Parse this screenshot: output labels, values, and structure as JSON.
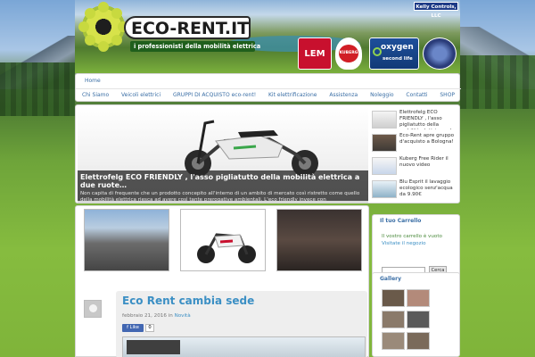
{
  "header": {
    "logo_text": "ECO-RENT.IT",
    "tagline": "i professionisti della mobilità elettrica",
    "top_badge": "Kelly Controls, LLC",
    "brands": [
      "LEM",
      "KUBERG",
      "oxygen",
      "second life"
    ]
  },
  "nav": {
    "home": "Home",
    "items": [
      "Chi Siamo",
      "Veicoli elettrici",
      "GRUPPI DI ACQUISTO eco-rent!",
      "Kit elettrificazione",
      "Assistenza",
      "Noleggio",
      "Contatti",
      "SHOP"
    ]
  },
  "slider": {
    "title": "Elettrofelg ECO FRIENDLY , l'asso pigliatutto della mobilità elettrica a due ruote…",
    "excerpt": "Non capita di frequente che un prodotto concepito all'interno di un ambito di mercato così ristretto come quello della mobilità elettrica riesca ad avere così tante prerogative ambientali. L'eco friendly invece con",
    "thumbs": [
      "Elettrofelg ECO FRIENDLY , l'asso pigliatutto della mobilità elettrica a due ruote…",
      "Eco-Rent apre gruppo d'acquisto a Bologna!",
      "Kuberg Free Rider il nuovo video",
      "Blu Esprit il lavaggio ecologico senz'acqua da 9.90€"
    ]
  },
  "post": {
    "title": "Eco Rent cambia sede",
    "date": "febbraio 21, 2016",
    "in_label": "in",
    "category": "Novità",
    "like_label": "f Like",
    "like_count": "0"
  },
  "sidebar": {
    "cart_title": "Il tuo Carrello",
    "cart_empty": "Il vostro carrello è vuoto",
    "cart_link": "Visitate il negozio",
    "search_placeholder": "",
    "search_button": "Cerca",
    "gallery_title": "Gallery"
  },
  "colors": {
    "link": "#3a6ea5",
    "post_title": "#3b8fc4",
    "accent_green": "#4a8a3c",
    "caption_bg": "#282828"
  }
}
